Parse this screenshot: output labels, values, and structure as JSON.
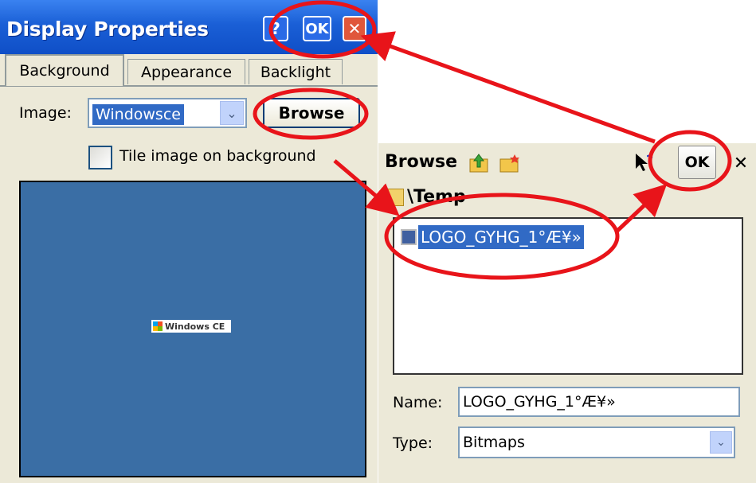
{
  "display_properties": {
    "title": "Display Properties",
    "help_glyph": "?",
    "ok_label": "OK",
    "close_glyph": "✕",
    "tabs": [
      {
        "label": "Background",
        "active": true
      },
      {
        "label": "Appearance",
        "active": false
      },
      {
        "label": "Backlight",
        "active": false
      }
    ],
    "image_label": "Image:",
    "image_value": "Windowsce",
    "dropdown_glyph": "⌄",
    "browse_label": "Browse",
    "tile_label": "Tile image on background",
    "tile_checked": false,
    "preview_logo_text": "Windows CE",
    "preview_bg_color": "#3a6ea5"
  },
  "browse_dialog": {
    "title": "Browse",
    "up_folder_icon": "folder-up-icon",
    "new_folder_icon": "new-folder-icon",
    "help_icon": "pointer-help-icon",
    "ok_label": "OK",
    "close_glyph": "✕",
    "path": "\\Temp",
    "files": [
      {
        "name": "LOGO_GYHG_1°Æ¥»",
        "selected": true,
        "icon": "bitmap-file-icon"
      }
    ],
    "name_label": "Name:",
    "name_value": "LOGO_GYHG_1°Æ¥»",
    "type_label": "Type:",
    "type_value": "Bitmaps",
    "dropdown_glyph": "⌄"
  },
  "annotation_color": "#e8141a"
}
